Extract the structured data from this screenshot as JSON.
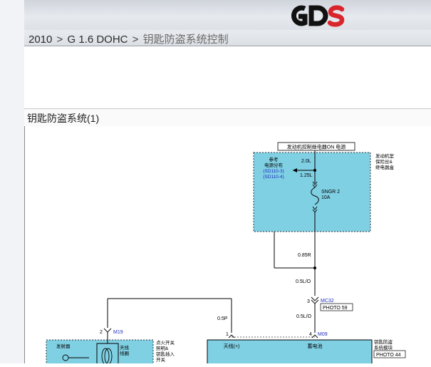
{
  "header": {
    "logo_text": "GDS",
    "breadcrumb": [
      "2010",
      "G 1.6 DOHC",
      "钥匙防盗系统控制"
    ]
  },
  "section": {
    "title": "钥匙防盗系统(1)"
  },
  "diagram": {
    "top_label": "发动机控制继电器ON  电源",
    "relay_box_label": [
      "发动机室",
      "保险丝&",
      "继电器盒"
    ],
    "ref_label": [
      "参考",
      "电源分布"
    ],
    "ref_links": [
      "(SD110-3)",
      "(SD110-4)"
    ],
    "wire_top": "2.0L",
    "wire_mid": "1.25L",
    "fuse_name": "SNGR 2",
    "fuse_amp": "10A",
    "wire_085r": "0.85R",
    "wire_05lo_1": "0.5L/O",
    "connector_mc32": "MC32",
    "photo_59": "PHOTO 59",
    "wire_05lo_2": "0.5L/O",
    "wire_05p": "0.5P",
    "pin_2": "2",
    "connector_m19": "M19",
    "pin_1": "1",
    "pin_4": "4",
    "connector_m09": "M09",
    "pin_3": "3",
    "transmitter": "发射器",
    "antenna_coil": [
      "天线",
      "线圈"
    ],
    "ignition_switch_label": [
      "点火开关",
      "照明&",
      "钥匙插入",
      "开关"
    ],
    "terminal_antenna": "天线(+)",
    "terminal_battery": "蓄电池",
    "immobilizer_label": [
      "钥匙防盗",
      "系统模块"
    ],
    "photo_44": "PHOTO 44"
  },
  "colors": {
    "box_fill": "#80d0e4",
    "wire": "#000000",
    "link_blue": "#1f2fbf"
  }
}
